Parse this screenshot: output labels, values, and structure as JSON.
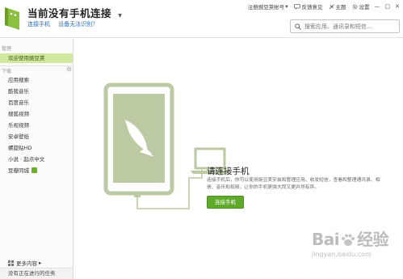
{
  "header": {
    "title": "当前没有手机连接",
    "links": [
      "连接手机",
      "设备无法识别？"
    ],
    "menu": [
      {
        "label": "注册豌豆荚帐号",
        "caret": "▾"
      },
      {
        "label": "反馈意见"
      },
      {
        "label": "主题"
      },
      {
        "label": "设置"
      }
    ],
    "window": {
      "minimize": "—",
      "maximize": "□",
      "close": "✕"
    },
    "search_placeholder": "搜索应用、通讯录和短信..."
  },
  "sidebar": {
    "section_manage": "管理",
    "welcome_item": "欢迎使用豌豆荚",
    "section_download": "下载",
    "download_items": [
      "应用搜索",
      "酷我音乐",
      "百度音乐",
      "搜狐视频",
      "乐视视频",
      "安卓壁纸",
      "螺旋贴HD",
      "小说 · 起点中文",
      "豆瓣同城"
    ],
    "more_label": "更多内容",
    "more_caret": "▸",
    "tasks_label": "没有正在进行的任务"
  },
  "main": {
    "connect_title": "请连接手机",
    "connect_desc": "连接手机后，你可以使用豌豆荚安装和管理应用、收发短信，查看和整理通讯录、相册、音乐和视频，让你的手机更强大而又更井然有序。",
    "connect_button": "连接手机",
    "watermark_main_a": "Bai",
    "watermark_main_b": "经验",
    "watermark_sub": "jingyan.baidu.com"
  },
  "colors": {
    "accent": "#5faa2a",
    "illustration": "#bccaa3",
    "link": "#2d6fb5"
  }
}
